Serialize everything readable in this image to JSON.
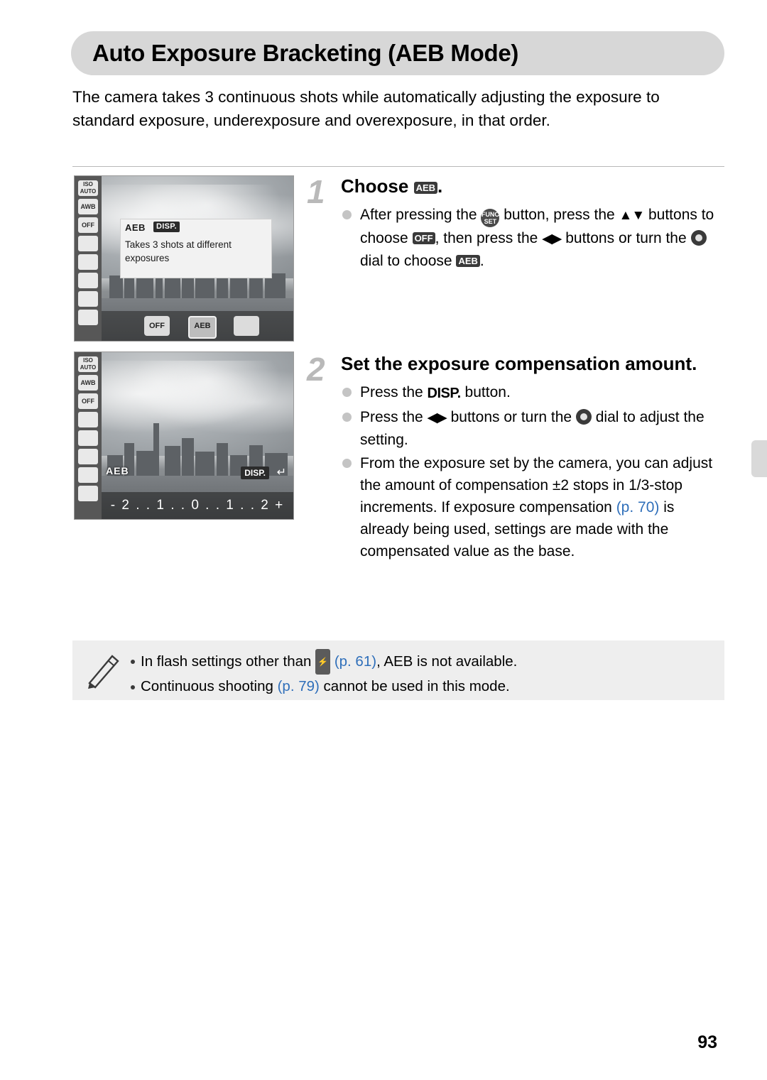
{
  "page": {
    "title": "Auto Exposure Bracketing (AEB Mode)",
    "intro": "The camera takes 3 continuous shots while automatically adjusting the exposure to standard exposure, underexposure and overexposure, in that order.",
    "number": "93"
  },
  "screens": {
    "screen1": {
      "rail": [
        "ISO AUTO",
        "AWB",
        "OFF",
        "flash-seq",
        "flash",
        "metering",
        "frame",
        "quality"
      ],
      "tooltip": {
        "label": "AEB",
        "badge": "DISP.",
        "body": "Takes 3 shots at different exposures"
      },
      "mode_items": [
        "OFF",
        "AEB",
        "focus-bkt"
      ]
    },
    "screen2": {
      "rail": [
        "ISO AUTO",
        "AWB",
        "OFF",
        "flash-seq",
        "flash",
        "metering",
        "frame",
        "quality"
      ],
      "aeb_label": "AEB",
      "disp_badge": "DISP.",
      "return_icon": "return-arrow",
      "scale": "- 2 . . 1 . . 0 . . 1 . . 2 +"
    }
  },
  "steps": [
    {
      "num": "1",
      "title_before": "Choose ",
      "title_icon": "aeb-icon",
      "title_after": ".",
      "bullets": [
        {
          "parts": [
            {
              "t": "text",
              "v": "After pressing the "
            },
            {
              "t": "func",
              "v": "FUNC SET"
            },
            {
              "t": "text",
              "v": " button, press the "
            },
            {
              "t": "updown",
              "v": "▲▼"
            },
            {
              "t": "text",
              "v": " buttons to choose "
            },
            {
              "t": "chip",
              "v": "OFF"
            },
            {
              "t": "text",
              "v": ", then press the "
            },
            {
              "t": "leftright",
              "v": "◀▶"
            },
            {
              "t": "text",
              "v": " buttons or turn the "
            },
            {
              "t": "dial",
              "v": "dial"
            },
            {
              "t": "text",
              "v": " dial to choose "
            },
            {
              "t": "chip",
              "v": "AEB"
            },
            {
              "t": "text",
              "v": "."
            }
          ]
        }
      ]
    },
    {
      "num": "2",
      "title_before": "Set the exposure compensation amount.",
      "bullets": [
        {
          "parts": [
            {
              "t": "text",
              "v": "Press the "
            },
            {
              "t": "disp",
              "v": "DISP."
            },
            {
              "t": "text",
              "v": " button."
            }
          ]
        },
        {
          "parts": [
            {
              "t": "text",
              "v": "Press the "
            },
            {
              "t": "leftright",
              "v": "◀▶"
            },
            {
              "t": "text",
              "v": " buttons or turn the "
            },
            {
              "t": "dial",
              "v": "dial"
            },
            {
              "t": "text",
              "v": " dial to adjust the setting."
            }
          ]
        },
        {
          "parts": [
            {
              "t": "text",
              "v": "From the exposure set by the camera, you can adjust the amount of compensation ±2 stops in 1/3-stop increments. If exposure compensation "
            },
            {
              "t": "link",
              "v": "(p. 70)"
            },
            {
              "t": "text",
              "v": " is already being used, settings are made with the compensated value as the base."
            }
          ]
        }
      ]
    }
  ],
  "note": {
    "icon": "pencil-icon",
    "lines": [
      {
        "parts": [
          {
            "t": "text",
            "v": "In flash settings other than "
          },
          {
            "t": "flashoff",
            "v": "flash-off-icon"
          },
          {
            "t": "text",
            "v": " "
          },
          {
            "t": "link",
            "v": "(p. 61)"
          },
          {
            "t": "text",
            "v": ", AEB is not available."
          }
        ]
      },
      {
        "parts": [
          {
            "t": "text",
            "v": "Continuous shooting "
          },
          {
            "t": "link",
            "v": "(p. 79)"
          },
          {
            "t": "text",
            "v": " cannot be used in this mode."
          }
        ]
      }
    ]
  },
  "colors": {
    "title_bar": "#d7d7d7",
    "note_bg": "#eeeeee",
    "link": "#2f6fba",
    "step_number": "#b9b9b9"
  }
}
